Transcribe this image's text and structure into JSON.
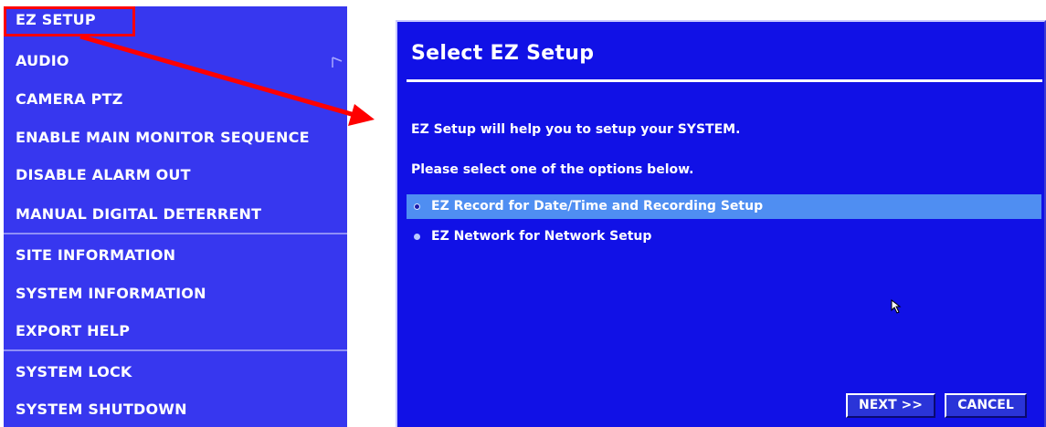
{
  "menu": {
    "items": [
      {
        "label": "EZ SETUP"
      },
      {
        "label": "AUDIO"
      },
      {
        "label": "CAMERA PTZ"
      },
      {
        "label": "ENABLE MAIN MONITOR SEQUENCE"
      },
      {
        "label": "DISABLE ALARM OUT"
      },
      {
        "label": "MANUAL DIGITAL DETERRENT"
      },
      {
        "label": "SITE INFORMATION"
      },
      {
        "label": "SYSTEM INFORMATION"
      },
      {
        "label": "EXPORT HELP"
      },
      {
        "label": "SYSTEM LOCK"
      },
      {
        "label": "SYSTEM SHUTDOWN"
      }
    ],
    "submenu_icon": "submenu-arrow-icon"
  },
  "annotation": {
    "highlight_color": "#ff0000",
    "highlighted_item": "EZ SETUP",
    "arrow_icon": "red-pointer-arrow"
  },
  "dialog": {
    "title": "Select EZ Setup",
    "intro": "EZ Setup will help you to setup your SYSTEM.",
    "prompt": "Please select one of the options below.",
    "options": [
      {
        "label": "EZ Record for Date/Time and Recording Setup",
        "selected": true
      },
      {
        "label": "EZ Network for Network Setup",
        "selected": false
      }
    ],
    "buttons": {
      "next": "NEXT >>",
      "cancel": "CANCEL"
    }
  },
  "colors": {
    "menu_background": "#3737ef",
    "dialog_background": "#1111e6",
    "selected_option": "#4f8ef2",
    "text": "#ffffff"
  }
}
